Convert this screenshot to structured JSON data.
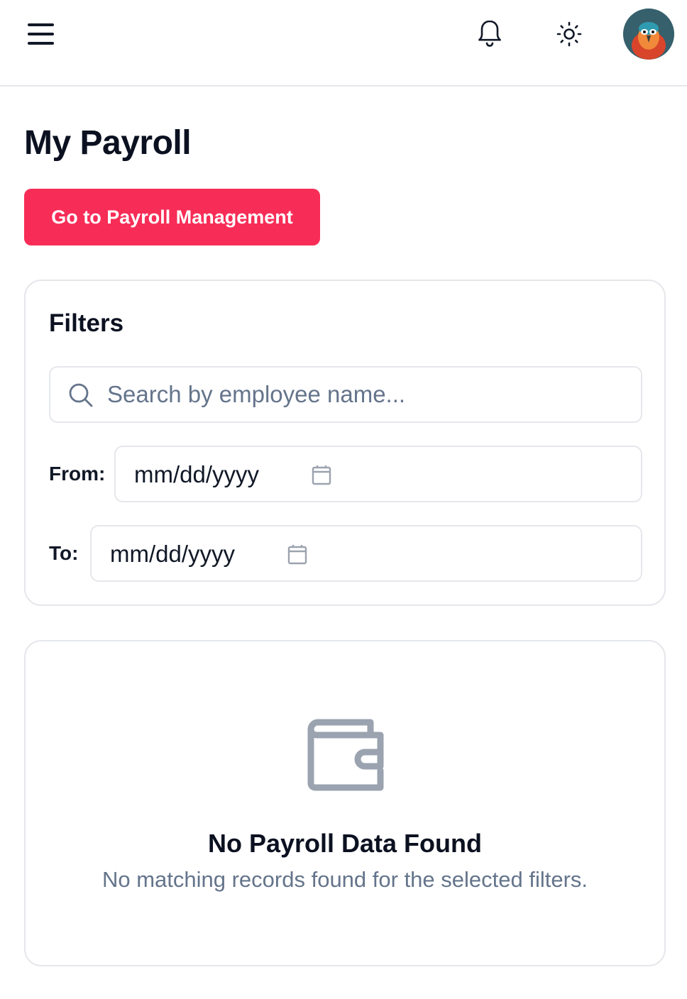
{
  "header": {
    "menu_icon": "hamburger-menu-icon",
    "notification_icon": "bell-icon",
    "theme_icon": "sun-icon",
    "avatar": "user-avatar"
  },
  "page": {
    "title": "My Payroll",
    "cta_label": "Go to Payroll Management",
    "cta_color": "#f72d57"
  },
  "filters": {
    "heading": "Filters",
    "search_placeholder": "Search by employee name...",
    "search_value": "",
    "from_label": "From:",
    "from_value": "mm/dd/yyyy",
    "to_label": "To:",
    "to_value": "mm/dd/yyyy"
  },
  "empty_state": {
    "icon": "wallet-icon",
    "title": "No Payroll Data Found",
    "message": "No matching records found for the selected filters."
  }
}
